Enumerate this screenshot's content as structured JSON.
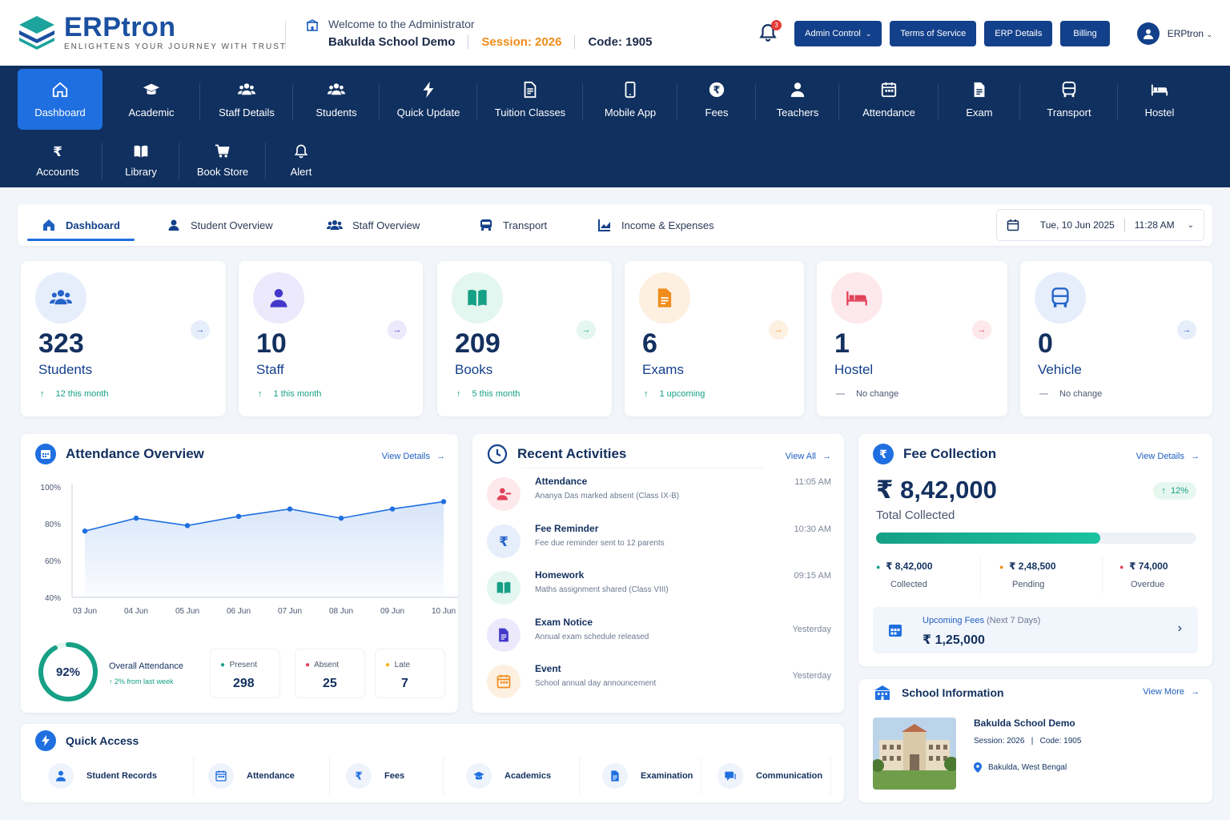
{
  "brand": {
    "name": "ERPtron",
    "tagline": "ENLIGHTENS YOUR JOURNEY WITH TRUST"
  },
  "header": {
    "welcome": "Welcome to the Administrator",
    "school": "Bakulda School Demo",
    "session": "Session: 2026",
    "code": "Code: 1905",
    "notif_count": "3",
    "buttons": [
      "Admin Control",
      "Terms of Service",
      "ERP Details",
      "Billing"
    ],
    "user": "ERPtron"
  },
  "nav": {
    "row1": [
      {
        "label": "Dashboard",
        "icon": "home-icon"
      },
      {
        "label": "Academic",
        "icon": "graduation-cap-icon"
      },
      {
        "label": "Staff Details",
        "icon": "users-icon"
      },
      {
        "label": "Students",
        "icon": "users-icon"
      },
      {
        "label": "Quick Update",
        "icon": "bolt-icon"
      },
      {
        "label": "Tuition Classes",
        "icon": "document-icon"
      },
      {
        "label": "Mobile App",
        "icon": "mobile-icon"
      },
      {
        "label": "Fees",
        "icon": "rupee-circle-icon"
      },
      {
        "label": "Teachers",
        "icon": "user-icon"
      },
      {
        "label": "Attendance",
        "icon": "calendar-icon"
      },
      {
        "label": "Exam",
        "icon": "file-icon"
      },
      {
        "label": "Transport",
        "icon": "bus-icon"
      },
      {
        "label": "Hostel",
        "icon": "bed-icon"
      }
    ],
    "row2": [
      {
        "label": "Accounts",
        "icon": "rupee-icon"
      },
      {
        "label": "Library",
        "icon": "book-icon"
      },
      {
        "label": "Book Store",
        "icon": "cart-icon"
      },
      {
        "label": "Alert",
        "icon": "bell-icon"
      }
    ]
  },
  "tabs": [
    "Dashboard",
    "Student Overview",
    "Staff Overview",
    "Transport",
    "Income & Expenses"
  ],
  "datetime": {
    "date": "Tue, 10 Jun 2025",
    "time": "11:28 AM"
  },
  "stats": [
    {
      "value": "323",
      "label": "Students",
      "delta": "12  this month",
      "color": "#2563c9",
      "bg": "#e6eefb",
      "trend": "up"
    },
    {
      "value": "10",
      "label": "Staff",
      "delta": "1  this month",
      "color": "#4338ca",
      "bg": "#ebe9fb",
      "trend": "up"
    },
    {
      "value": "209",
      "label": "Books",
      "delta": "5  this month",
      "color": "#16a085",
      "bg": "#e3f6f0",
      "trend": "up"
    },
    {
      "value": "6",
      "label": "Exams",
      "delta": "1  upcoming",
      "color": "#f08c1a",
      "bg": "#fdf0e1",
      "trend": "up"
    },
    {
      "value": "1",
      "label": "Hostel",
      "delta": "No change",
      "color": "#e2435a",
      "bg": "#fde8ec",
      "trend": "flat"
    },
    {
      "value": "0",
      "label": "Vehicle",
      "delta": "No change",
      "color": "#2563c9",
      "bg": "#e6eefb",
      "trend": "flat"
    }
  ],
  "attendance": {
    "title": "Attendance Overview",
    "link": "View Details",
    "overall_pct": "92%",
    "overall_label": "Overall Attendance",
    "overall_delta": "2% from last week",
    "overall_value": 0.92,
    "present_label": "Present",
    "present": "298",
    "absent_label": "Absent",
    "absent": "25",
    "late_label": "Late",
    "late": "7"
  },
  "chart_data": {
    "type": "area",
    "x": [
      "03 Jun",
      "04 Jun",
      "05 Jun",
      "06 Jun",
      "07 Jun",
      "08 Jun",
      "09 Jun",
      "10 Jun"
    ],
    "series": [
      {
        "values": [
          76,
          83,
          79,
          84,
          88,
          83,
          88,
          92
        ]
      }
    ],
    "yticks": [
      "100%",
      "80%",
      "60%",
      "40%"
    ],
    "ylim": [
      40,
      100
    ],
    "grid": false
  },
  "activities": {
    "title": "Recent Activities",
    "link": "View All",
    "items": [
      {
        "title": "Attendance",
        "desc": "Ananya Das marked absent (Class IX-B)",
        "time": "11:05 AM",
        "icon": "user-minus-icon",
        "color": "#e2435a",
        "bg": "#fde8ec"
      },
      {
        "title": "Fee Reminder",
        "desc": "Fee due reminder sent to 12 parents",
        "time": "10:30 AM",
        "icon": "rupee-icon",
        "color": "#2563c9",
        "bg": "#e6eefb"
      },
      {
        "title": "Homework",
        "desc": "Maths assignment shared (Class VIII)",
        "time": "09:15 AM",
        "icon": "book-icon",
        "color": "#16a085",
        "bg": "#e3f6f0"
      },
      {
        "title": "Exam Notice",
        "desc": "Annual exam schedule released",
        "time": "Yesterday",
        "icon": "file-icon",
        "color": "#4338ca",
        "bg": "#ebe9fb"
      },
      {
        "title": "Event",
        "desc": "School annual day announcement",
        "time": "Yesterday",
        "icon": "calendar-icon",
        "color": "#f08c1a",
        "bg": "#fdf0e1"
      }
    ]
  },
  "fees": {
    "title": "Fee Collection",
    "link": "View Details",
    "total": "₹ 8,42,000",
    "total_label": "Total Collected",
    "growth": "12%",
    "progress": 0.7,
    "collected": "₹ 8,42,000",
    "collected_label": "Collected",
    "pending": "₹ 2,48,500",
    "pending_label": "Pending",
    "overdue": "₹ 74,000",
    "overdue_label": "Overdue",
    "upcoming_label": "Upcoming Fees",
    "upcoming_range": "(Next 7 Days)",
    "upcoming_value": "₹ 1,25,000"
  },
  "school": {
    "title": "School Information",
    "link": "View More",
    "name": "Bakulda School Demo",
    "session": "Session: 2026",
    "code": "Code: 1905",
    "location": "Bakulda, West Bengal"
  },
  "quick": {
    "title": "Quick Access",
    "items": [
      "Student Records",
      "Attendance",
      "Fees",
      "Academics",
      "Examination",
      "Communication"
    ]
  }
}
